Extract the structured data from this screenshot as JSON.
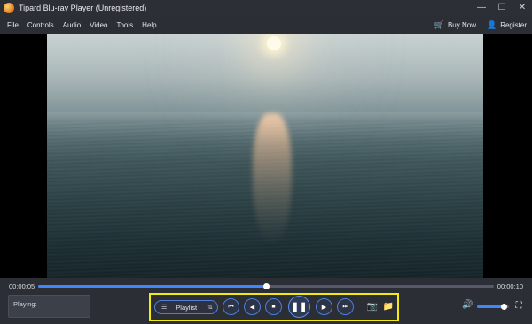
{
  "window": {
    "title": "Tipard Blu-ray Player (Unregistered)",
    "controls": {
      "minimize": "—",
      "maximize": "☐",
      "close": "✕"
    }
  },
  "menu": {
    "items": [
      "File",
      "Controls",
      "Audio",
      "Video",
      "Tools",
      "Help"
    ],
    "buy_now": "Buy Now",
    "register": "Register"
  },
  "playback": {
    "current_time": "00:00:05",
    "total_time": "00:00:10",
    "progress_fraction": 0.5,
    "playing_label": "Playing:"
  },
  "controls": {
    "playlist_label": "Playlist",
    "volume_fraction": 0.85
  },
  "icons": {
    "playlist": "☰",
    "sort": "⇅",
    "prev": "⏮",
    "rewind": "◀",
    "stop": "■",
    "pause": "❚❚",
    "forward": "▶",
    "next": "⏭",
    "snapshot": "📷",
    "open_folder": "📁",
    "volume": "🔊",
    "fullscreen": "⛶",
    "cart": "🛒",
    "register": "👤"
  },
  "colors": {
    "accent": "#3f86ff",
    "highlight_frame": "#f1ea17",
    "background": "#2b2e35"
  }
}
